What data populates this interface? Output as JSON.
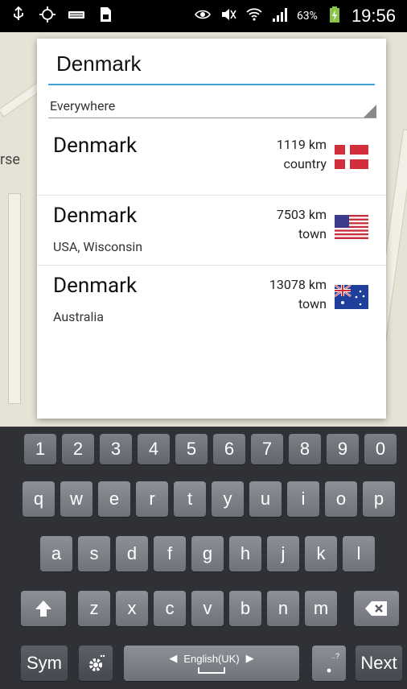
{
  "status_bar": {
    "battery_percent": "63%",
    "time": "19:56"
  },
  "map": {
    "edge_label": "rse"
  },
  "search": {
    "query": "Denmark",
    "filter_label": "Everywhere"
  },
  "results": [
    {
      "name": "Denmark",
      "region": "",
      "distance": "1119 km",
      "type": "country",
      "flag": "denmark-flag"
    },
    {
      "name": "Denmark",
      "region": "USA, Wisconsin",
      "distance": "7503 km",
      "type": "town",
      "flag": "usa-flag"
    },
    {
      "name": "Denmark",
      "region": "Australia",
      "distance": "13078 km",
      "type": "town",
      "flag": "australia-flag"
    }
  ],
  "keyboard": {
    "numbers": [
      "1",
      "2",
      "3",
      "4",
      "5",
      "6",
      "7",
      "8",
      "9",
      "0"
    ],
    "row1": [
      "q",
      "w",
      "e",
      "r",
      "t",
      "y",
      "u",
      "i",
      "o",
      "p"
    ],
    "row2": [
      "a",
      "s",
      "d",
      "f",
      "g",
      "h",
      "j",
      "k",
      "l"
    ],
    "row3": [
      "z",
      "x",
      "c",
      "v",
      "b",
      "n",
      "m"
    ],
    "sym_label": "Sym",
    "language": "English(UK)",
    "next_label": "Next"
  }
}
